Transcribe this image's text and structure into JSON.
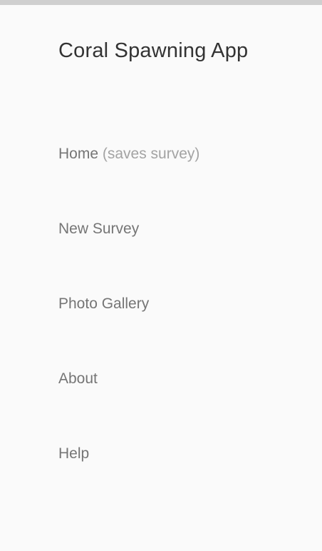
{
  "colors": {
    "drawer_background": "#fafafa",
    "title_text": "#333333",
    "menu_text": "#757575",
    "hint_text": "#a3a3a3"
  },
  "drawer": {
    "title": "Coral Spawning App",
    "items": [
      {
        "label": "Home",
        "hint": "(saves survey)"
      },
      {
        "label": "New Survey"
      },
      {
        "label": "Photo Gallery"
      },
      {
        "label": "About"
      },
      {
        "label": "Help"
      }
    ]
  }
}
